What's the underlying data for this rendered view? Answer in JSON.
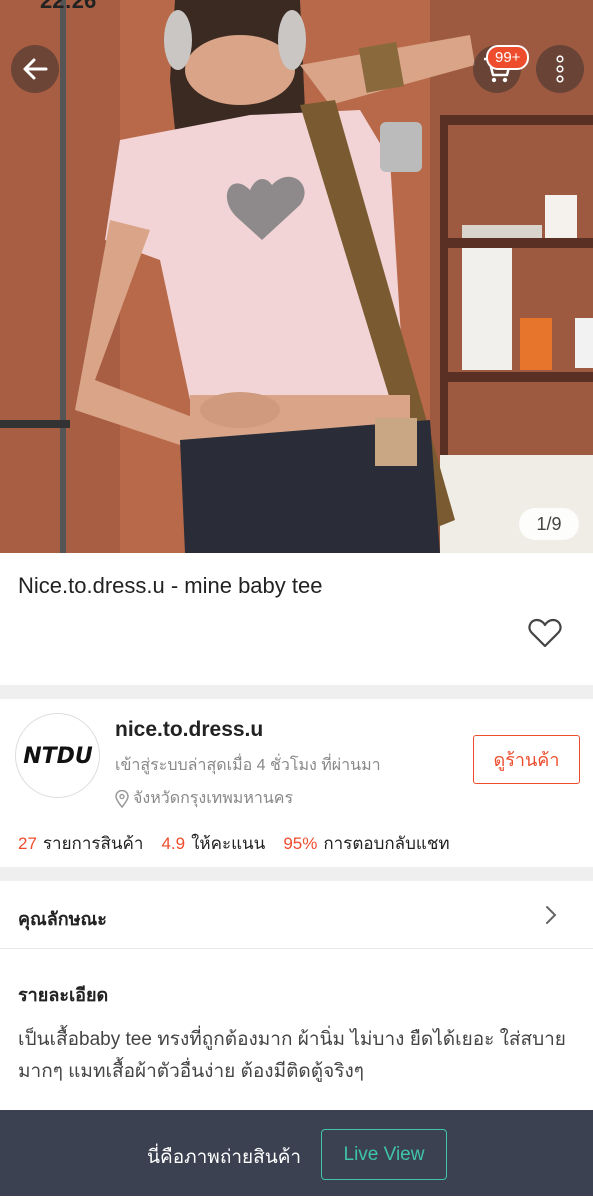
{
  "status": {
    "time": "22:26"
  },
  "cart": {
    "badge": "99+"
  },
  "image_counter": "1/9",
  "product": {
    "title": "Nice.to.dress.u - mine baby tee"
  },
  "shop": {
    "logo_text": "NTDU",
    "name": "nice.to.dress.u",
    "last_active": "เข้าสู่ระบบล่าสุดเมื่อ 4 ชั่วโมง ที่ผ่านมา",
    "location": "จังหวัดกรุงเทพมหานคร",
    "view_shop_label": "ดูร้านค้า",
    "stats": [
      {
        "value": "27",
        "label": "รายการสินค้า"
      },
      {
        "value": "4.9",
        "label": "ให้คะแนน"
      },
      {
        "value": "95%",
        "label": "การตอบกลับแชท"
      }
    ]
  },
  "attributes": {
    "label": "คุณลักษณะ"
  },
  "detail": {
    "title": "รายละเอียด",
    "body": "เป็นเสื้อbaby tee ทรงที่ถูกต้องมาก ผ้านิ่ม ไม่บาง ยืดได้เยอะ ใส่สบายมากๆ แมทเสื้อผ้าตัวอื่นง่าย ต้องมีติดตู้จริงๆ"
  },
  "bottom_bar": {
    "text": "นี่คือภาพถ่ายสินค้า",
    "live_label": "Live View",
    "live_color": "#3fc4a8"
  },
  "colors": {
    "accent": "#ee4d2d",
    "bar_bg": "#3b4150"
  }
}
